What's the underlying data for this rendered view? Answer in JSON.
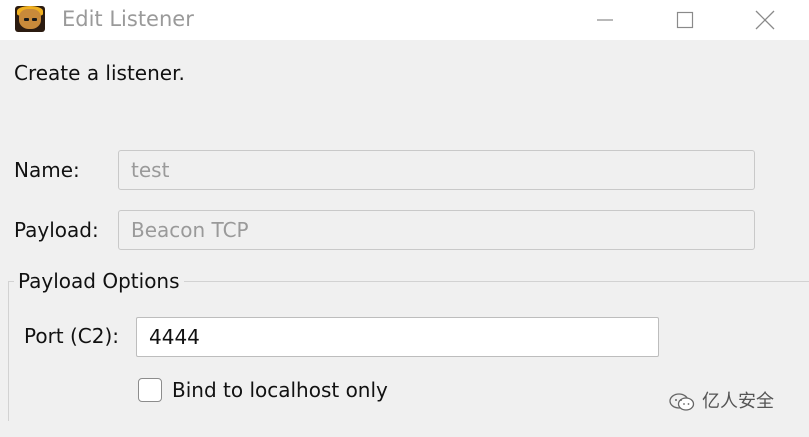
{
  "window": {
    "title": "Edit Listener",
    "icon": "app-avatar-icon"
  },
  "controls": {
    "minimize_icon": "minimize-icon",
    "maximize_icon": "maximize-icon",
    "close_icon": "close-icon"
  },
  "intro_text": "Create a listener.",
  "form": {
    "name_label": "Name:",
    "name_value": "test",
    "payload_label": "Payload:",
    "payload_value": "Beacon TCP"
  },
  "payload_options": {
    "group_title": "Payload Options",
    "port_label": "Port (C2):",
    "port_value": "4444",
    "bind_localhost_label": "Bind to localhost only",
    "bind_localhost_checked": false
  },
  "watermark": {
    "text": "亿人安全",
    "icon": "wechat-icon"
  }
}
